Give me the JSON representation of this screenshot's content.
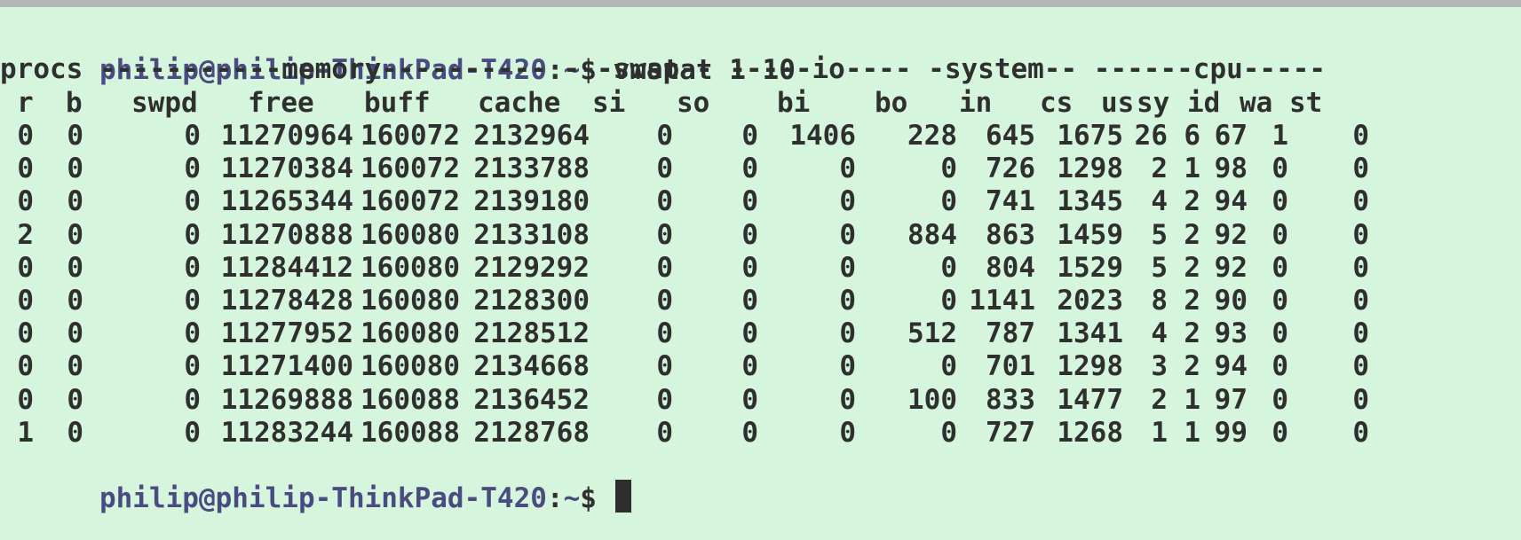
{
  "terminal": {
    "command": {
      "user_host": "philip@philip-ThinkPad-T420",
      "separator": ":",
      "path": "~",
      "symbol": "$",
      "text": " vmstat 1 10"
    },
    "section_header": "procs -----------memory---------- ---swap-- -----io---- -system-- ------cpu-----",
    "column_headers": [
      "r",
      "b",
      "swpd",
      "free",
      "buff",
      "cache",
      "si",
      "so",
      "bi",
      "bo",
      "in",
      "cs",
      "us",
      "sy",
      "id",
      "wa",
      "st"
    ],
    "rows": [
      [
        "0",
        "0",
        "0",
        "11270964",
        "160072",
        "2132964",
        "0",
        "0",
        "1406",
        "228",
        "645",
        "1675",
        "26",
        "6",
        "67",
        "1",
        "0"
      ],
      [
        "0",
        "0",
        "0",
        "11270384",
        "160072",
        "2133788",
        "0",
        "0",
        "0",
        "0",
        "726",
        "1298",
        "2",
        "1",
        "98",
        "0",
        "0"
      ],
      [
        "0",
        "0",
        "0",
        "11265344",
        "160072",
        "2139180",
        "0",
        "0",
        "0",
        "0",
        "741",
        "1345",
        "4",
        "2",
        "94",
        "0",
        "0"
      ],
      [
        "2",
        "0",
        "0",
        "11270888",
        "160080",
        "2133108",
        "0",
        "0",
        "0",
        "884",
        "863",
        "1459",
        "5",
        "2",
        "92",
        "0",
        "0"
      ],
      [
        "0",
        "0",
        "0",
        "11284412",
        "160080",
        "2129292",
        "0",
        "0",
        "0",
        "0",
        "804",
        "1529",
        "5",
        "2",
        "92",
        "0",
        "0"
      ],
      [
        "0",
        "0",
        "0",
        "11278428",
        "160080",
        "2128300",
        "0",
        "0",
        "0",
        "0",
        "1141",
        "2023",
        "8",
        "2",
        "90",
        "0",
        "0"
      ],
      [
        "0",
        "0",
        "0",
        "11277952",
        "160080",
        "2128512",
        "0",
        "0",
        "0",
        "512",
        "787",
        "1341",
        "4",
        "2",
        "93",
        "0",
        "0"
      ],
      [
        "0",
        "0",
        "0",
        "11271400",
        "160080",
        "2134668",
        "0",
        "0",
        "0",
        "0",
        "701",
        "1298",
        "3",
        "2",
        "94",
        "0",
        "0"
      ],
      [
        "0",
        "0",
        "0",
        "11269888",
        "160088",
        "2136452",
        "0",
        "0",
        "0",
        "100",
        "833",
        "1477",
        "2",
        "1",
        "97",
        "0",
        "0"
      ],
      [
        "1",
        "0",
        "0",
        "11283244",
        "160088",
        "2128768",
        "0",
        "0",
        "0",
        "0",
        "727",
        "1268",
        "1",
        "1",
        "99",
        "0",
        "0"
      ]
    ],
    "final_prompt": {
      "user_host": "philip@philip-ThinkPad-T420",
      "separator": ":",
      "path": "~",
      "symbol": "$"
    },
    "colors": {
      "background": "#d5f6dd",
      "prompt": "#4a4b80",
      "text": "#2f2f2f",
      "cursor": "#2d2d2d"
    }
  }
}
